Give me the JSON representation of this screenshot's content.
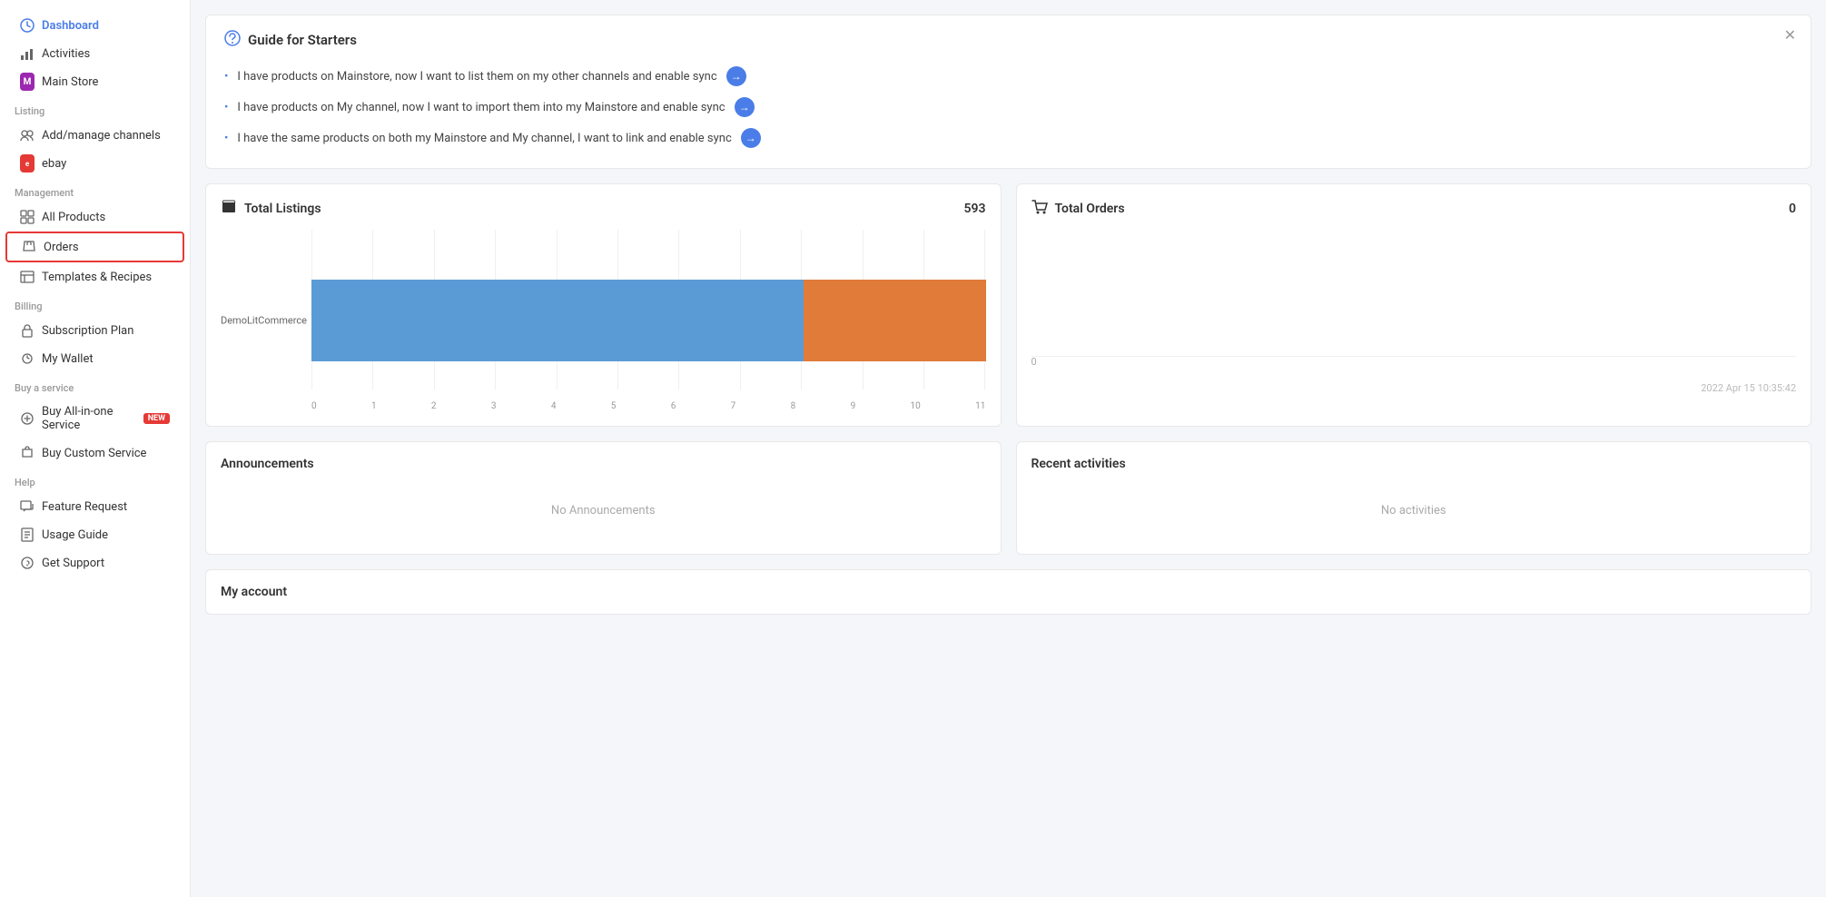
{
  "sidebar": {
    "dashboard": {
      "label": "Dashboard",
      "active": true
    },
    "activities": {
      "label": "Activities"
    },
    "main_store": {
      "label": "Main Store"
    },
    "sections": {
      "listing": "Listing",
      "management": "Management",
      "billing": "Billing",
      "buy_service": "Buy a service",
      "help": "Help"
    },
    "listing_items": [
      {
        "label": "Add/manage channels",
        "icon": "👥"
      },
      {
        "label": "ebay",
        "icon": "ebay"
      }
    ],
    "management_items": [
      {
        "label": "All Products",
        "icon": "🛍"
      },
      {
        "label": "Orders",
        "icon": "📁",
        "highlighted": true
      },
      {
        "label": "Templates & Recipes",
        "icon": "📄"
      }
    ],
    "billing_items": [
      {
        "label": "Subscription Plan",
        "icon": "🔒"
      },
      {
        "label": "My Wallet",
        "icon": "👤"
      }
    ],
    "service_items": [
      {
        "label": "Buy All-in-one Service",
        "icon": "⚙",
        "badge": "NEW"
      },
      {
        "label": "Buy Custom Service",
        "icon": "🎁"
      }
    ],
    "help_items": [
      {
        "label": "Feature Request",
        "icon": "💬"
      },
      {
        "label": "Usage Guide",
        "icon": "📖"
      },
      {
        "label": "Get Support",
        "icon": "❓"
      }
    ]
  },
  "guide": {
    "title": "Guide for Starters",
    "items": [
      "I have products on Mainstore, now I want to list them on my other channels and enable sync",
      "I have products on My channel, now I want to import them into my Mainstore and enable sync",
      "I have the same products on both my Mainstore and My channel, I want to link and enable sync"
    ]
  },
  "total_listings": {
    "title": "Total Listings",
    "count": "593",
    "chart": {
      "y_label": "DemoLitCommerce",
      "x_axis": [
        "0",
        "1",
        "2",
        "3",
        "4",
        "5",
        "6",
        "7",
        "8",
        "9",
        "10",
        "11"
      ],
      "bar_blue_pct": 73,
      "bar_orange_pct": 27
    }
  },
  "total_orders": {
    "title": "Total Orders",
    "count": "0",
    "timestamp": "2022 Apr 15 10:35:42"
  },
  "announcements": {
    "title": "Announcements",
    "empty_text": "No Announcements"
  },
  "recent_activities": {
    "title": "Recent activities",
    "empty_text": "No activities"
  },
  "my_account": {
    "title": "My account"
  }
}
